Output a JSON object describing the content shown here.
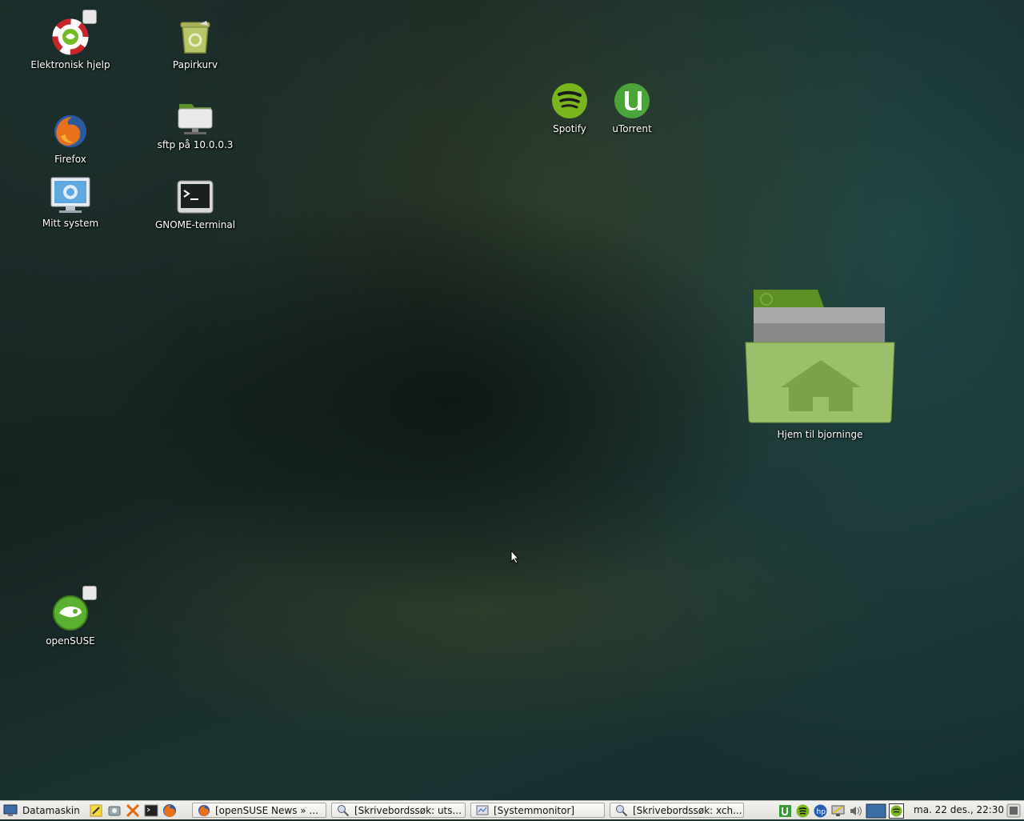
{
  "desktop": {
    "icons": {
      "help": "Elektronisk hjelp",
      "trash": "Papirkurv",
      "firefox": "Firefox",
      "sftp": "sftp på 10.0.0.3",
      "mysystem": "Mitt system",
      "terminal": "GNOME-terminal",
      "spotify": "Spotify",
      "utorrent": "uTorrent",
      "home": "Hjem til bjorninge",
      "opensuse": "openSUSE"
    }
  },
  "taskbar": {
    "menu_label": "Datamaskin",
    "tasks": [
      "[openSUSE News » ...",
      "[Skrivebordssøk: uts...",
      "[Systemmonitor]",
      "[Skrivebordssøk: xch..."
    ],
    "clock": "ma. 22 des., 22:30"
  },
  "colors": {
    "suse_green": "#73ba25",
    "taskbar_bg": "#e9e8e3"
  }
}
